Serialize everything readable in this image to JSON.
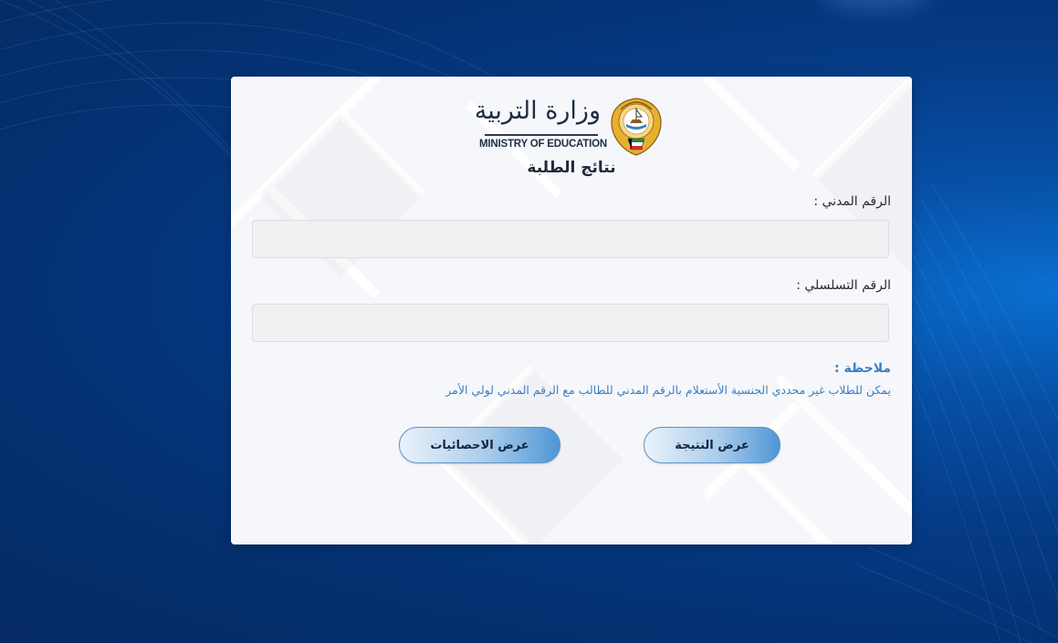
{
  "header": {
    "logo_ar": "وزارة التربية",
    "logo_en": "MINISTRY OF EDUCATION",
    "page_title": "نتائج الطلبة"
  },
  "form": {
    "civil_id_label": "الرقم المدني :",
    "civil_id_value": "",
    "serial_label": "الرقم التسلسلي :",
    "serial_value": ""
  },
  "note": {
    "title": "ملاحظة :",
    "text": "يمكن للطلاب غير محددي الجنسية الأستعلام بالرقم المدني للطالب مع الرقم المدني لولي الأمر"
  },
  "buttons": {
    "show_result": "عرض النتيجة",
    "show_stats": "عرض الاحصائيات"
  },
  "colors": {
    "background": "#053a85",
    "accent": "#3b7fc4",
    "card": "#f6f7fa"
  },
  "icons": {
    "emblem": "kuwait-emblem-icon"
  }
}
